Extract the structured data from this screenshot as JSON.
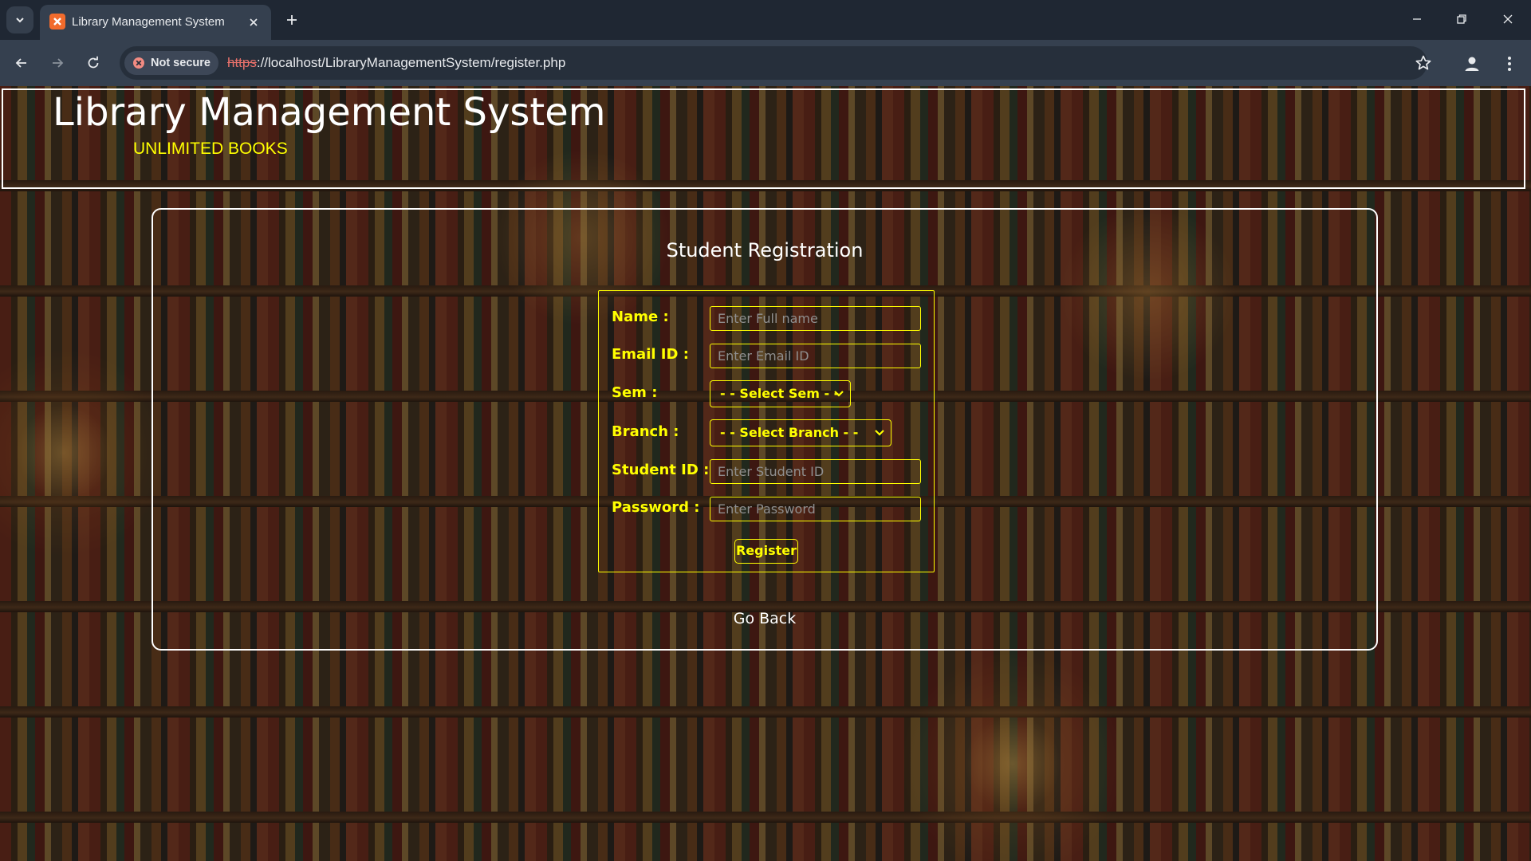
{
  "browser": {
    "tab_title": "Library Management System",
    "security_label": "Not secure",
    "url_scheme": "https",
    "url_rest": "://localhost/LibraryManagementSystem/register.php"
  },
  "header": {
    "title": "Library Management System",
    "tagline": "UNLIMITED BOOKS"
  },
  "form": {
    "heading": "Student Registration",
    "fields": {
      "name": {
        "label": "Name :",
        "placeholder": "Enter Full name"
      },
      "email": {
        "label": "Email ID :",
        "placeholder": "Enter Email ID"
      },
      "sem": {
        "label": "Sem :",
        "selected": "- - Select Sem - -"
      },
      "branch": {
        "label": "Branch :",
        "selected": "- - Select Branch - -"
      },
      "student_id": {
        "label": "Student ID :",
        "placeholder": "Enter Student ID"
      },
      "password": {
        "label": "Password :",
        "placeholder": "Enter Password"
      }
    },
    "submit_label": "Register",
    "back_label": "Go Back"
  },
  "colors": {
    "accent": "#ffff00",
    "text": "#ffffff",
    "chrome_bg": "#1f2733",
    "toolbar_bg": "#35404f"
  }
}
